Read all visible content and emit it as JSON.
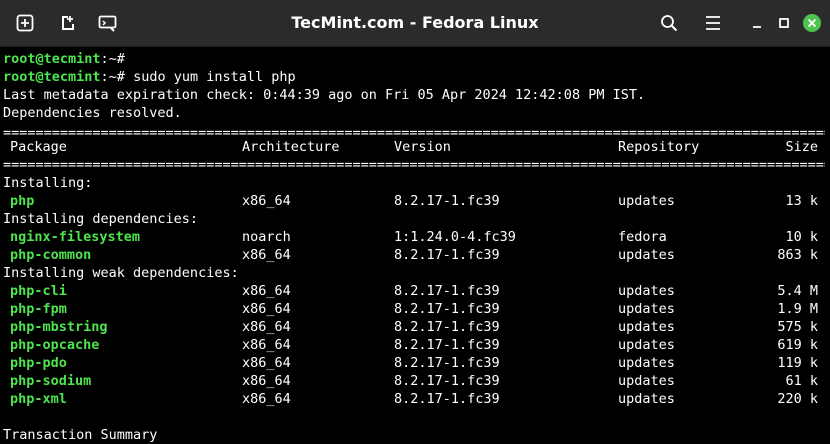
{
  "window": {
    "title": "TecMint.com - Fedora Linux",
    "icons": [
      "new-tab-icon",
      "new-window-icon",
      "preferences-icon",
      "search-icon",
      "menu-icon",
      "minimize-icon",
      "maximize-icon",
      "close-icon"
    ],
    "close_color": "#4ec24e"
  },
  "terminal": {
    "prompt_user": "root@tecmint",
    "prompt_path": ":~#",
    "command": " sudo yum install php",
    "line_meta": "Last metadata expiration check: 0:44:39 ago on Fri 05 Apr 2024 12:42:08 PM IST.",
    "line_deps": "Dependencies resolved.",
    "rule": "================================================================================================================================",
    "headers": {
      "package": "Package",
      "arch": "Architecture",
      "version": "Version",
      "repo": "Repository",
      "size": "Size"
    },
    "sections": {
      "installing": "Installing:",
      "deps": "Installing dependencies:",
      "weak": "Installing weak dependencies:"
    },
    "rows": [
      {
        "pkg": "php",
        "arch": "x86_64",
        "ver": "8.2.17-1.fc39",
        "repo": "updates",
        "size": "13 k"
      },
      {
        "pkg": "nginx-filesystem",
        "arch": "noarch",
        "ver": "1:1.24.0-4.fc39",
        "repo": "fedora",
        "size": "10 k"
      },
      {
        "pkg": "php-common",
        "arch": "x86_64",
        "ver": "8.2.17-1.fc39",
        "repo": "updates",
        "size": "863 k"
      },
      {
        "pkg": "php-cli",
        "arch": "x86_64",
        "ver": "8.2.17-1.fc39",
        "repo": "updates",
        "size": "5.4 M"
      },
      {
        "pkg": "php-fpm",
        "arch": "x86_64",
        "ver": "8.2.17-1.fc39",
        "repo": "updates",
        "size": "1.9 M"
      },
      {
        "pkg": "php-mbstring",
        "arch": "x86_64",
        "ver": "8.2.17-1.fc39",
        "repo": "updates",
        "size": "575 k"
      },
      {
        "pkg": "php-opcache",
        "arch": "x86_64",
        "ver": "8.2.17-1.fc39",
        "repo": "updates",
        "size": "619 k"
      },
      {
        "pkg": "php-pdo",
        "arch": "x86_64",
        "ver": "8.2.17-1.fc39",
        "repo": "updates",
        "size": "119 k"
      },
      {
        "pkg": "php-sodium",
        "arch": "x86_64",
        "ver": "8.2.17-1.fc39",
        "repo": "updates",
        "size": "61 k"
      },
      {
        "pkg": "php-xml",
        "arch": "x86_64",
        "ver": "8.2.17-1.fc39",
        "repo": "updates",
        "size": "220 k"
      }
    ],
    "summary": "Transaction Summary"
  }
}
